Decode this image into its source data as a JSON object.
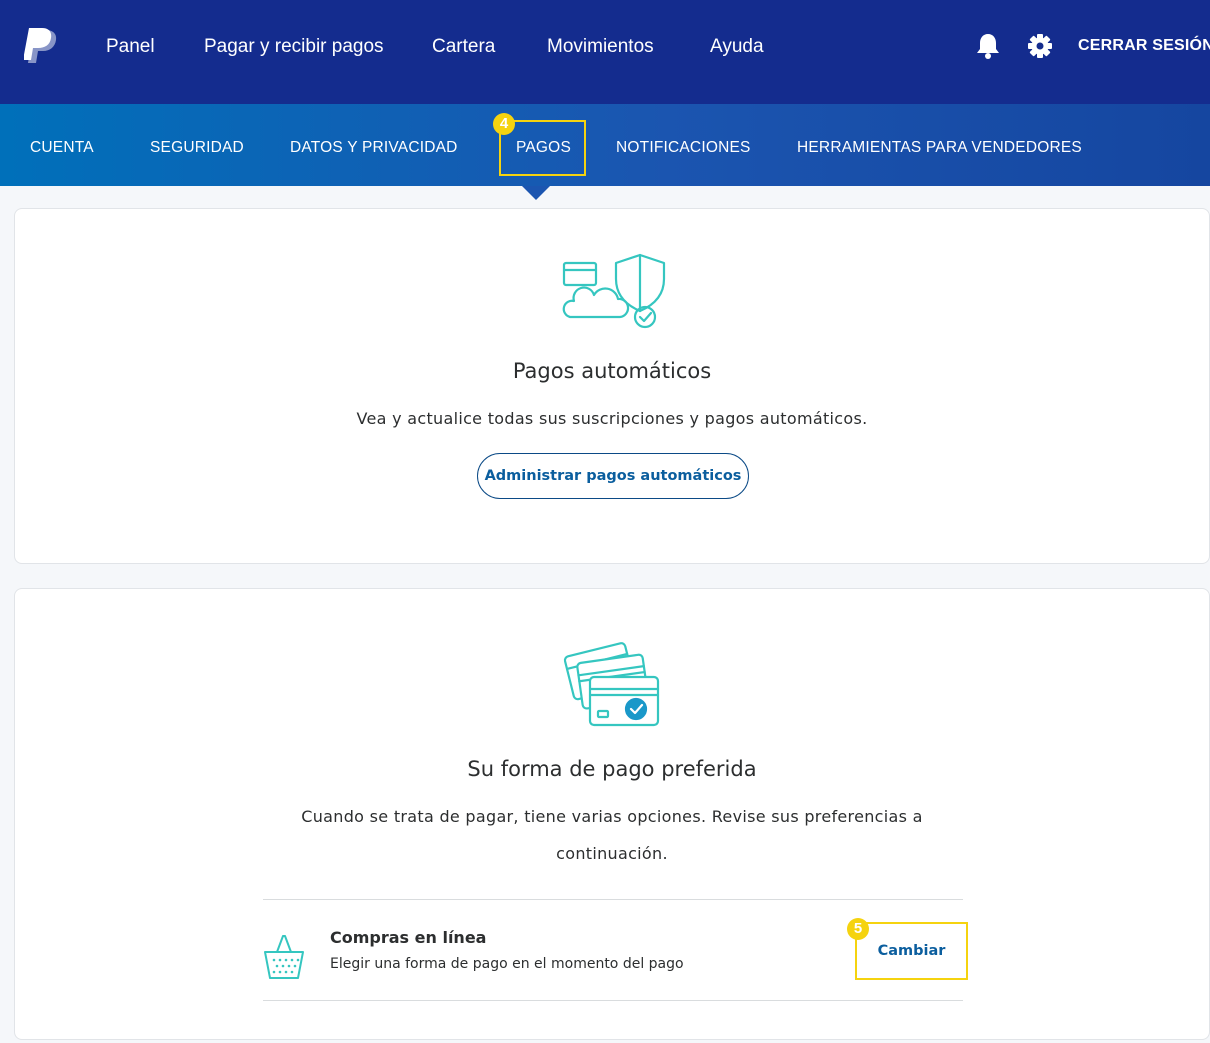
{
  "header": {
    "nav": [
      {
        "label": "Panel"
      },
      {
        "label": "Pagar y recibir pagos"
      },
      {
        "label": "Cartera"
      },
      {
        "label": "Movimientos"
      },
      {
        "label": "Ayuda"
      }
    ],
    "logout_label": "CERRAR SESIÓN"
  },
  "settings_tabs": [
    {
      "label": "CUENTA"
    },
    {
      "label": "SEGURIDAD"
    },
    {
      "label": "DATOS Y PRIVACIDAD"
    },
    {
      "label": "PAGOS"
    },
    {
      "label": "NOTIFICACIONES"
    },
    {
      "label": "HERRAMIENTAS PARA VENDEDORES"
    }
  ],
  "annotations": {
    "step4": "4",
    "step5": "5"
  },
  "automatic_payments": {
    "title": "Pagos automáticos",
    "description": "Vea y actualice todas sus suscripciones y pagos automáticos.",
    "button_label": "Administrar pagos automáticos"
  },
  "preferred_payment": {
    "title": "Su forma de pago preferida",
    "description_line1": "Cuando se trata de pagar, tiene varias opciones. Revise sus preferencias a",
    "description_line2": "continuación.",
    "row": {
      "title": "Compras en línea",
      "subtitle": "Elegir una forma de pago en el momento del pago",
      "action_label": "Cambiar"
    }
  },
  "colors": {
    "header_bg": "#142c8e",
    "subnav_bg": "#0070ba",
    "highlight": "#f5d30f",
    "link": "#0b5e9e",
    "illustration": "#35c6c0"
  }
}
